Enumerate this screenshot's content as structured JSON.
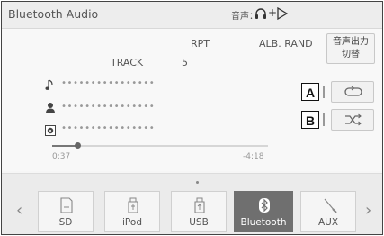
{
  "header": {
    "title": "Bluetooth Audio",
    "audio_output_label": "音声：",
    "icons": [
      "headphones-icon",
      "speaker-icon"
    ]
  },
  "playback": {
    "rpt_label": "RPT",
    "alb_rand_label": "ALB. RAND",
    "track_label": "TRACK",
    "track_number": "5",
    "switch_output_line1": "音声出力",
    "switch_output_line2": "切替",
    "title_placeholder": "••••••••••••••••",
    "artist_placeholder": "••••••••••••••••",
    "album_placeholder": "••••••••••••••••",
    "elapsed": "0:37",
    "remaining": "-4:18",
    "progress_fraction": 0.115
  },
  "callouts": {
    "a": "A",
    "b": "B"
  },
  "controls": {
    "repeat_icon": "repeat-icon",
    "shuffle_icon": "shuffle-icon"
  },
  "sources": [
    {
      "label": "SD",
      "icon": "sd-card-icon",
      "active": false
    },
    {
      "label": "iPod",
      "icon": "ipod-icon",
      "active": false
    },
    {
      "label": "USB",
      "icon": "usb-icon",
      "active": false
    },
    {
      "label": "Bluetooth",
      "icon": "bluetooth-icon",
      "active": true
    },
    {
      "label": "AUX",
      "icon": "aux-icon",
      "active": false
    }
  ],
  "colors": {
    "active_source_bg": "#6f6f6f",
    "background": "#f6f6f6"
  }
}
